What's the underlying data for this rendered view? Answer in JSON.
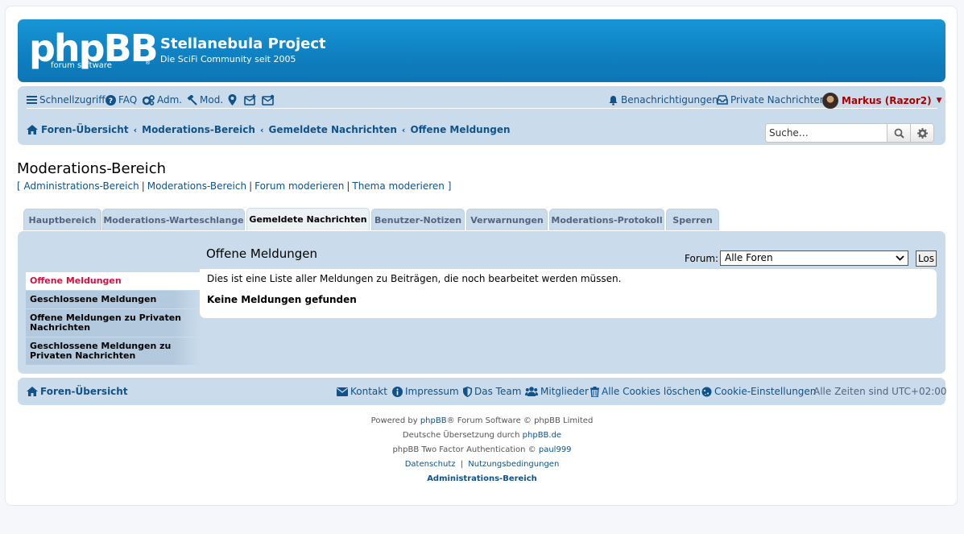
{
  "header": {
    "logo_text": "phpBB",
    "logo_sub": "forum   software",
    "logo_reg": "®",
    "site_title": "Stellanebula Project",
    "site_desc": "Die SciFi Community seit 2005"
  },
  "navbar": {
    "quicklinks": "Schnellzugriff",
    "faq": "FAQ",
    "adm": "Adm.",
    "mod": "Mod.",
    "notifications": "Benachrichtigungen",
    "private_messages": "Private Nachrichten",
    "user": "Markus (Razor2)",
    "user_color": "#aa0000"
  },
  "breadcrumbs": [
    "Foren-Übersicht",
    "Moderations-Bereich",
    "Gemeldete Nachrichten",
    "Offene Meldungen"
  ],
  "search": {
    "placeholder": "Suche…"
  },
  "page": {
    "title": "Moderations-Bereich",
    "links": [
      "Administrations-Bereich",
      "Moderations-Bereich",
      "Forum moderieren",
      "Thema moderieren"
    ]
  },
  "tabs": [
    "Hauptbereich",
    "Moderations-Warteschlange",
    "Gemeldete Nachrichten",
    "Benutzer-Notizen",
    "Verwarnungen",
    "Moderations-Protokoll",
    "Sperren"
  ],
  "active_tab": "Gemeldete Nachrichten",
  "sidebar": [
    "Offene Meldungen",
    "Geschlossene Meldungen",
    "Offene Meldungen zu Privaten Nachrichten",
    "Geschlossene Meldungen zu Privaten Nachrichten"
  ],
  "main": {
    "title": "Offene Meldungen",
    "forum_label": "Forum:",
    "forum_selected": "Alle Foren",
    "go_button": "Los",
    "description": "Dies ist eine Liste aller Meldungen zu Beiträgen, die noch bearbeitet werden müssen.",
    "empty": "Keine Meldungen gefunden"
  },
  "footer": {
    "home": "Foren-Übersicht",
    "contact": "Kontakt",
    "impressum": "Impressum",
    "team": "Das Team",
    "members": "Mitglieder",
    "delete_cookies": "Alle Cookies löschen",
    "cookie_settings": "Cookie-Einstellungen",
    "timezone": "Alle Zeiten sind UTC+02:00"
  },
  "copyright": {
    "powered_pre": "Powered by ",
    "powered_link": "phpBB",
    "powered_post": "® Forum Software © phpBB Limited",
    "translation_pre": "Deutsche Übersetzung durch ",
    "translation_link": "phpBB.de",
    "tfa_pre": "phpBB Two Factor Authentication © ",
    "tfa_link": "paul999",
    "privacy": "Datenschutz",
    "terms": "Nutzungsbedingungen",
    "acp": "Administrations-Bereich"
  }
}
